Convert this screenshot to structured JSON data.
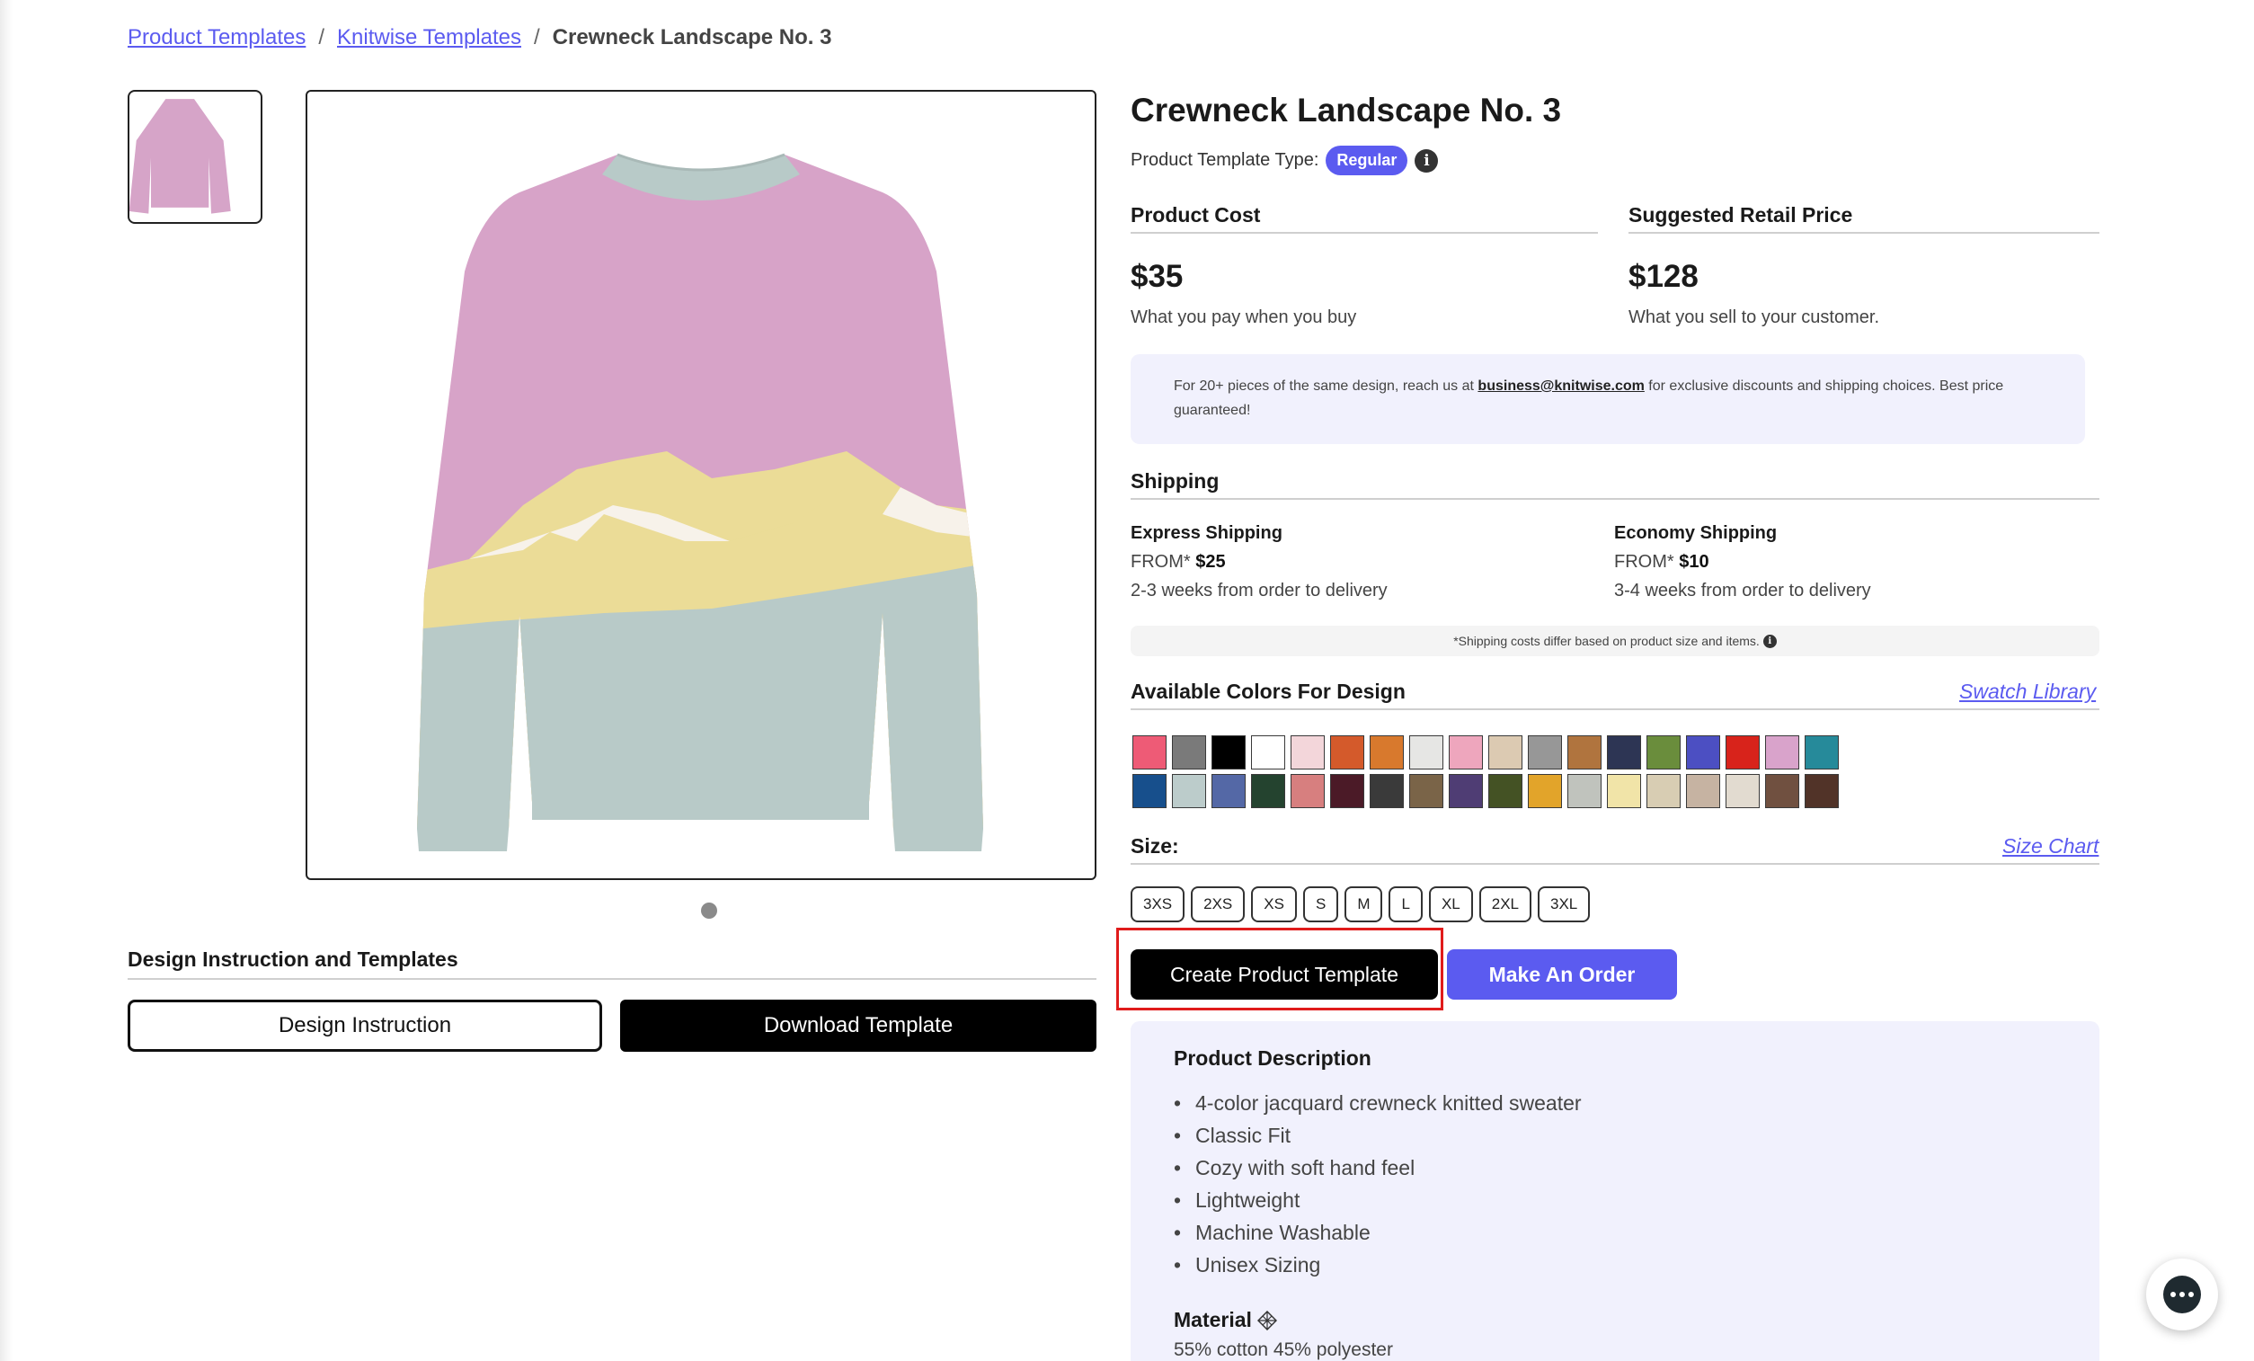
{
  "breadcrumb": {
    "items": [
      "Product Templates",
      "Knitwise Templates"
    ],
    "current": "Crewneck Landscape No. 3",
    "separator": "/"
  },
  "design": {
    "title": "Design Instruction and Templates",
    "instruction_button": "Design Instruction",
    "download_button": "Download Template"
  },
  "product": {
    "title": "Crewneck Landscape No. 3",
    "type_label": "Product Template Type:",
    "type_value": "Regular",
    "info_icon": "i"
  },
  "pricing": {
    "cost_header": "Product Cost",
    "cost_value": "$35",
    "cost_sub": "What you pay when you buy",
    "retail_header": "Suggested Retail Price",
    "retail_value": "$128",
    "retail_sub": "What you sell to your customer."
  },
  "bulk_note": {
    "prefix": "For 20+ pieces of the same design, reach us at ",
    "email": "business@knitwise.com",
    "suffix": " for exclusive discounts and shipping choices. Best price guaranteed!"
  },
  "shipping": {
    "title": "Shipping",
    "express_name": "Express Shipping",
    "express_from": "FROM*",
    "express_price": "$25",
    "express_time": "2-3 weeks from order to delivery",
    "economy_name": "Economy Shipping",
    "economy_from": "FROM*",
    "economy_price": "$10",
    "economy_time": "3-4 weeks from order to delivery",
    "note": "*Shipping costs differ based on product size and items."
  },
  "colors": {
    "title": "Available Colors For Design",
    "library_link": "Swatch Library",
    "swatches": [
      "#ee5b76",
      "#7a7a7a",
      "#000000",
      "#ffffff",
      "#f3d6da",
      "#d45a2b",
      "#d8792d",
      "#e6e6e4",
      "#eea6bd",
      "#dccab2",
      "#979797",
      "#b0743e",
      "#2d3554",
      "#6a8d3c",
      "#4c4fc2",
      "#d8231b",
      "#d9a3cb",
      "#268a9a",
      "#174f8c",
      "#bccccb",
      "#5468a6",
      "#24432f",
      "#d77f7f",
      "#4b1a27",
      "#3a3a3a",
      "#7a6448",
      "#4f3d74",
      "#445224",
      "#e2a42a",
      "#c0c3bd",
      "#f1e4a8",
      "#d8cdb3",
      "#c6b3a2",
      "#e2dbd0",
      "#705040",
      "#513328"
    ]
  },
  "size": {
    "title": "Size:",
    "chart_link": "Size Chart",
    "options": [
      "3XS",
      "2XS",
      "XS",
      "S",
      "M",
      "L",
      "XL",
      "2XL",
      "3XL"
    ]
  },
  "actions": {
    "create": "Create Product Template",
    "order": "Make An Order"
  },
  "description": {
    "title": "Product Description",
    "items": [
      "4-color jacquard crewneck knitted sweater",
      "Classic Fit",
      "Cozy with soft hand feel",
      "Lightweight",
      "Machine Washable",
      "Unisex Sizing"
    ],
    "material_title": "Material",
    "material_text": "55% cotton 45% polyester"
  }
}
